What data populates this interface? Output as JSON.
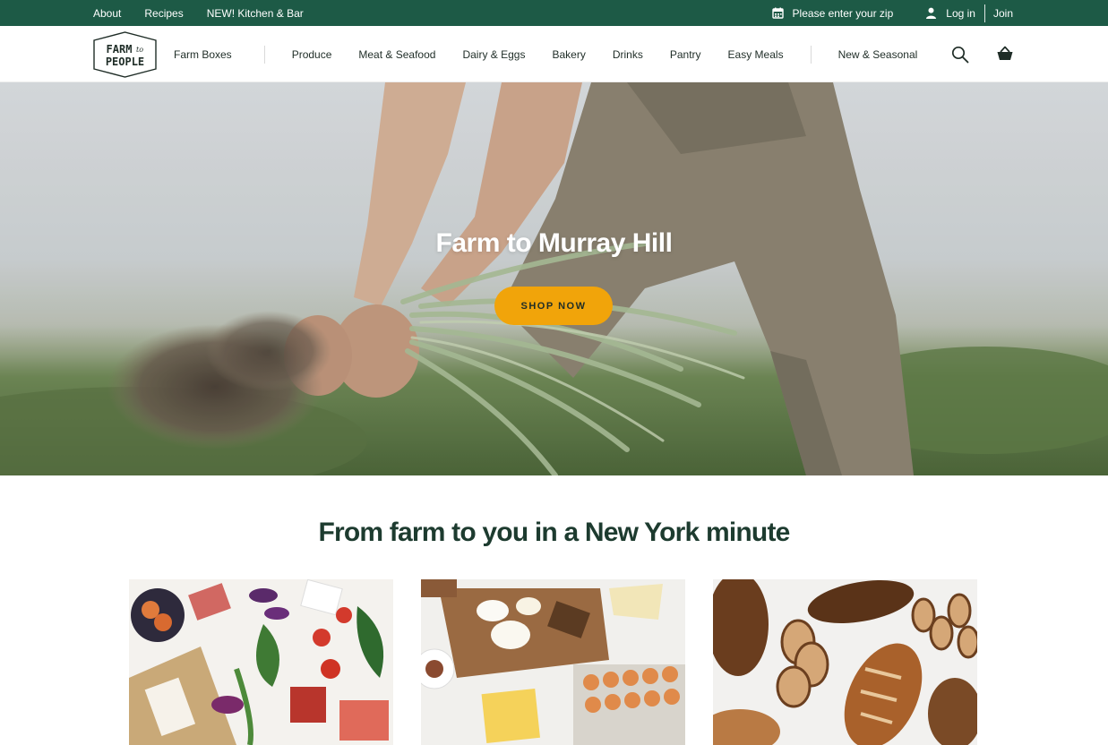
{
  "util_bar": {
    "links": [
      "About",
      "Recipes",
      "NEW! Kitchen & Bar"
    ],
    "zip_prompt": "Please enter your zip",
    "login": "Log in",
    "join": "Join",
    "zip_icon": "calendar-icon",
    "user_icon": "user-icon"
  },
  "logo": {
    "line1": "FARM",
    "connector": "to",
    "line2": "PEOPLE"
  },
  "nav": {
    "farm_boxes": "Farm Boxes",
    "categories": [
      "Produce",
      "Meat & Seafood",
      "Dairy & Eggs",
      "Bakery",
      "Drinks",
      "Pantry",
      "Easy Meals"
    ],
    "new_seasonal": "New & Seasonal",
    "search_icon": "search-icon",
    "basket_icon": "basket-icon"
  },
  "hero": {
    "title": "Farm to Murray Hill",
    "cta": "SHOP NOW"
  },
  "section": {
    "title": "From farm to you in a New York minute"
  },
  "cards": [
    {
      "image": "produce-spread"
    },
    {
      "image": "cheese-and-eggs"
    },
    {
      "image": "bread-loaves"
    }
  ],
  "colors": {
    "brand_green": "#1d5a46",
    "cta_orange": "#f1a40a",
    "heading": "#1d3b2f"
  }
}
